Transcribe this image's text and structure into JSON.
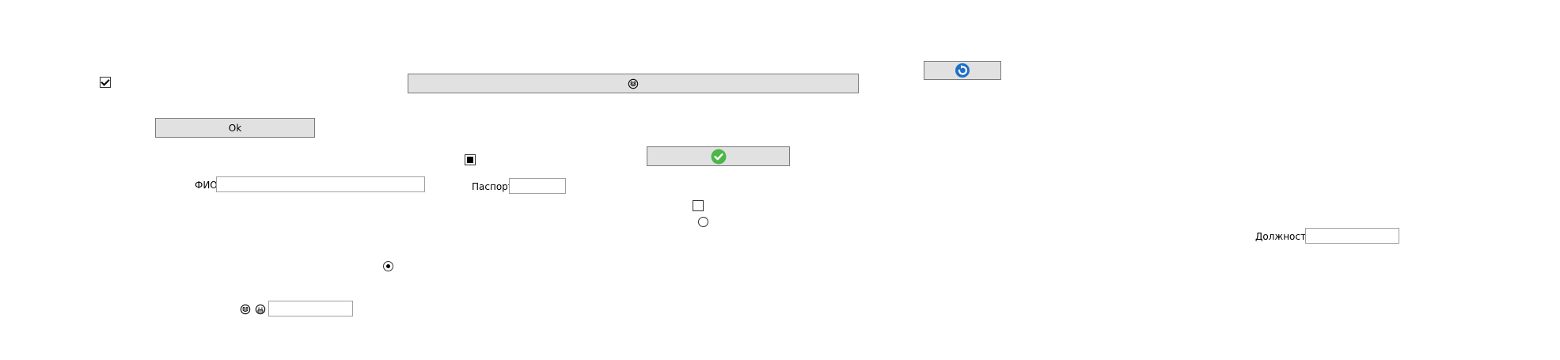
{
  "form": {
    "ok_button_label": "Ok",
    "fio_label": "ФИО",
    "fio_value": "",
    "passport_label": "Паспорт",
    "passport_value": "",
    "position_label": "Должность",
    "position_value": "",
    "emoji_field_value": ""
  },
  "states": {
    "checkbox_1": "checked",
    "checkbox_2": "indeterminate",
    "checkbox_3": "unchecked",
    "radio_1": "unchecked",
    "radio_2": "checked"
  },
  "icons": {
    "wide_button_icon": "smiley-face-icon",
    "ok_icon_button": "green-check-icon",
    "top_right_button_icon": "blue-refresh-icon",
    "emoji_left": "smiley-face-icon",
    "emoji_right": "grinning-face-icon"
  },
  "colors": {
    "button_bg": "#e1e1e1",
    "button_border": "#7a7a7a",
    "check_green": "#4cb648",
    "refresh_blue": "#1e6fc8"
  }
}
